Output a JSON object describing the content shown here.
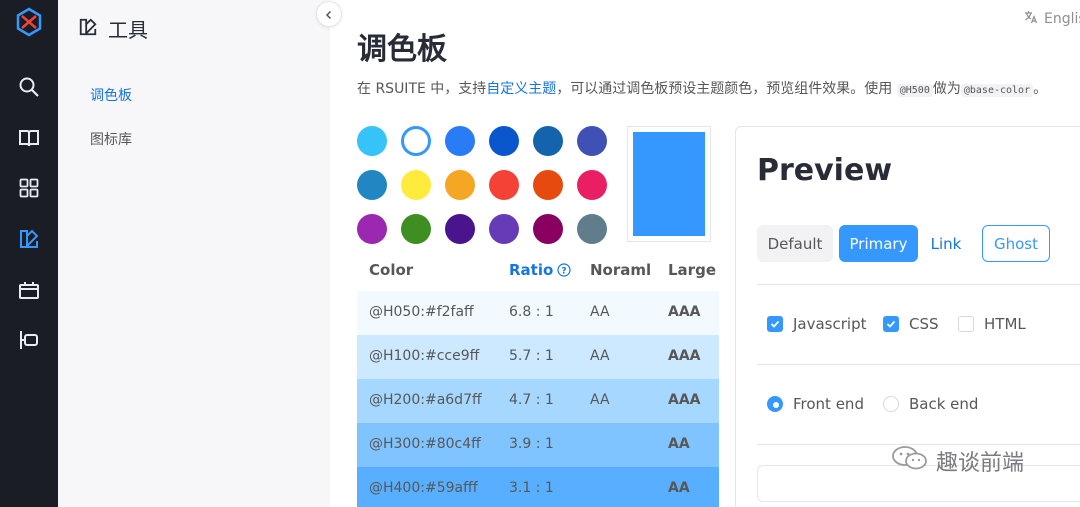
{
  "rail": {
    "items": [
      {
        "icon": "rsuite-logo-icon",
        "active": false
      },
      {
        "icon": "search-icon",
        "active": false
      },
      {
        "icon": "book-icon",
        "active": false
      },
      {
        "icon": "grid-icon",
        "active": false
      },
      {
        "icon": "palette-icon",
        "active": true
      },
      {
        "icon": "calendar-icon",
        "active": false
      },
      {
        "icon": "side-panel-icon",
        "active": false
      }
    ],
    "colors": {
      "bg": "#1a1d24",
      "icon": "#e9ebf0",
      "active": "#3498ff",
      "logo_blue": "#3498ff",
      "logo_red": "#f44336"
    }
  },
  "subnav": {
    "title": "工具",
    "items": [
      {
        "label": "调色板",
        "active": true
      },
      {
        "label": "图标库",
        "active": false
      }
    ],
    "colors": {
      "active": "#1675e0",
      "normal": "#575757"
    }
  },
  "lang": {
    "label": "Englis"
  },
  "page": {
    "title": "调色板",
    "intro": {
      "before": "在 RSUITE 中，支持",
      "link": "自定义主题",
      "after": "，可以通过调色板预设主题颜色，预览组件效果。使用 ",
      "code1": "@H500",
      "mid": "做为",
      "code2": "@base-color",
      "end": "。"
    }
  },
  "palette": {
    "swatches": [
      "#35c3f8",
      "#3498ff",
      "#2a7cf6",
      "#0a56cc",
      "#1464ad",
      "#3f51b5",
      "#2286c3",
      "#ffeb3b",
      "#f5a623",
      "#f44336",
      "#e64a0e",
      "#e91e63",
      "#9c27b0",
      "#3f8e22",
      "#4a148c",
      "#673ab7",
      "#8a0060",
      "#607d8b"
    ],
    "selected_index": 1,
    "preview_color": "#3498ff"
  },
  "table": {
    "headers": {
      "color": "Color",
      "ratio": "Ratio",
      "normal": "Noraml",
      "large": "Large"
    },
    "rows": [
      {
        "color": "@H050:#f2faff",
        "ratio": "6.8 : 1",
        "normal": "AA",
        "large": "AAA",
        "bg": "#f2faff"
      },
      {
        "color": "@H100:#cce9ff",
        "ratio": "5.7 : 1",
        "normal": "AA",
        "large": "AAA",
        "bg": "#cce9ff"
      },
      {
        "color": "@H200:#a6d7ff",
        "ratio": "4.7 : 1",
        "normal": "AA",
        "large": "AAA",
        "bg": "#a6d7ff"
      },
      {
        "color": "@H300:#80c4ff",
        "ratio": "3.9 : 1",
        "normal": "",
        "large": "AA",
        "bg": "#80c4ff"
      },
      {
        "color": "@H400:#59afff",
        "ratio": "3.1 : 1",
        "normal": "",
        "large": "AA",
        "bg": "#59afff"
      }
    ]
  },
  "preview": {
    "title": "Preview",
    "buttons": {
      "default": "Default",
      "primary": "Primary",
      "link": "Link",
      "ghost": "Ghost"
    },
    "checkboxes": [
      {
        "label": "Javascript",
        "checked": true
      },
      {
        "label": "CSS",
        "checked": true
      },
      {
        "label": "HTML",
        "checked": false
      }
    ],
    "radios": [
      {
        "label": "Front end",
        "checked": true
      },
      {
        "label": "Back end",
        "checked": false
      }
    ]
  },
  "watermark": {
    "text": "趣谈前端"
  }
}
